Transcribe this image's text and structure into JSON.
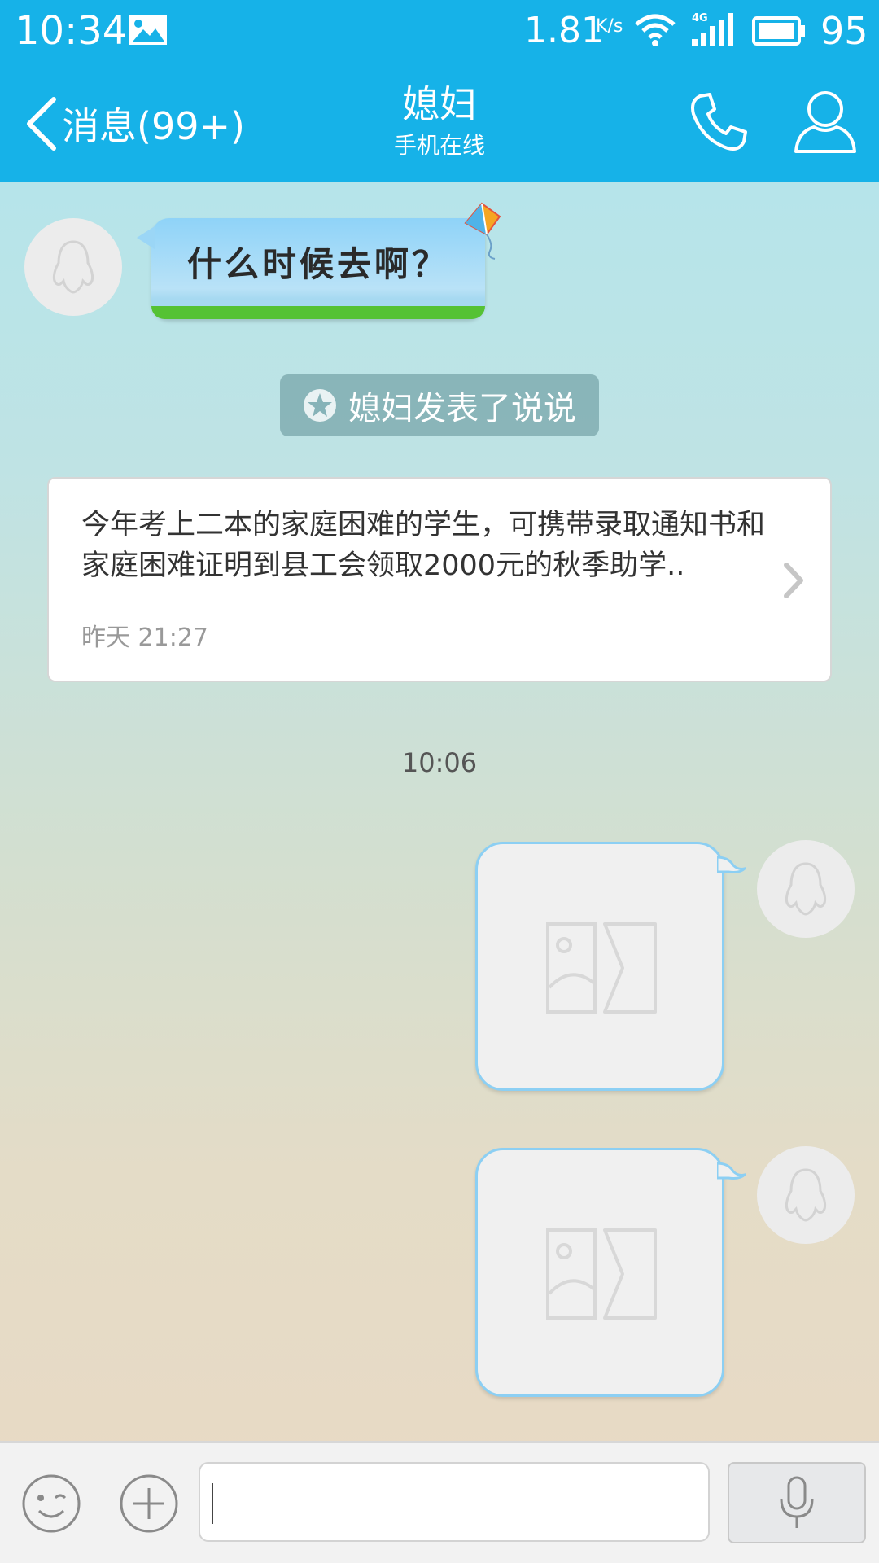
{
  "status_bar": {
    "time": "10:34",
    "speed": "1.81",
    "speed_unit": "K/s",
    "battery": "95"
  },
  "header": {
    "back_label": "消息(99+)",
    "title": "媳妇",
    "subtitle": "手机在线"
  },
  "messages": {
    "first_incoming": "什么时候去啊？",
    "notice": "媳妇发表了说说",
    "post_text": "今年考上二本的家庭困难的学生，可携带录取通知书和家庭困难证明到县工会领取2000元的秋季助学..",
    "post_time": "昨天 21:27",
    "timestamp": "10:06"
  },
  "input": {
    "value": ""
  },
  "colors": {
    "header_bg": "#16b2e8",
    "bubble_border": "#8ccff3"
  }
}
